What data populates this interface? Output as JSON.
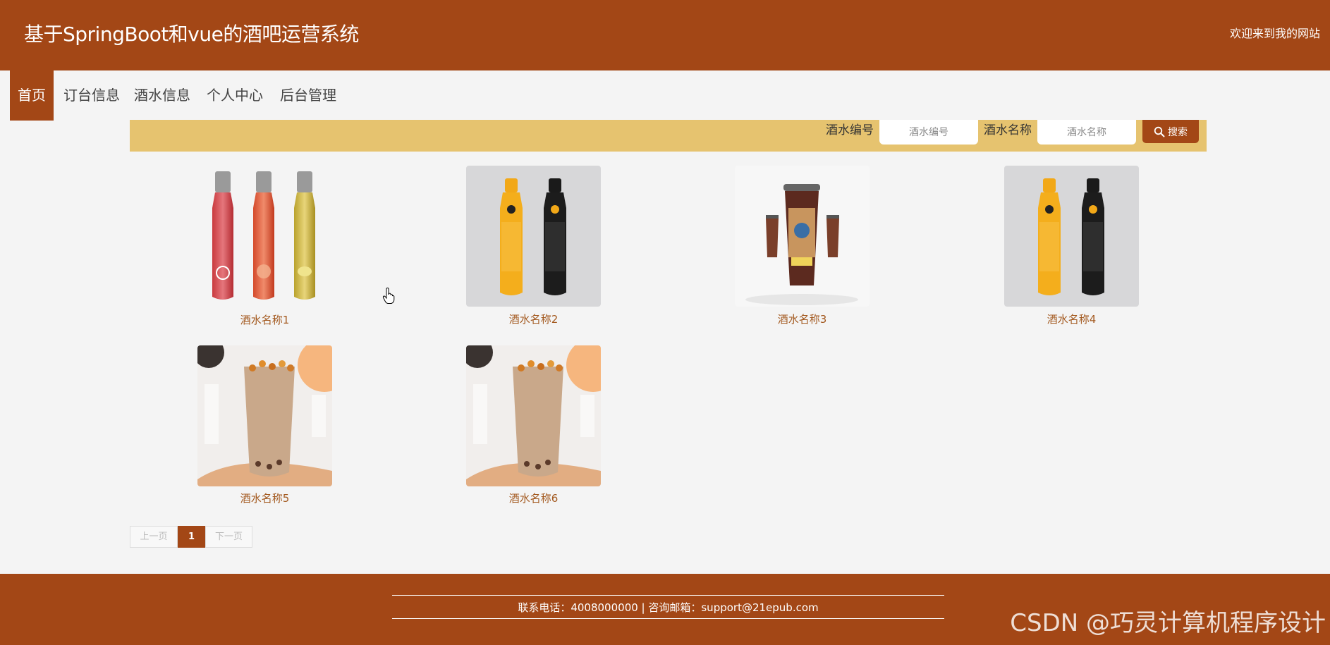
{
  "header": {
    "title": "基于SpringBoot和vue的酒吧运营系统",
    "welcome": "欢迎来到我的网站"
  },
  "nav": {
    "items": [
      {
        "label": "首页",
        "active": true
      },
      {
        "label": "订台信息"
      },
      {
        "label": "酒水信息"
      },
      {
        "label": "个人中心"
      },
      {
        "label": "后台管理"
      }
    ]
  },
  "search": {
    "number_label": "酒水编号",
    "number_placeholder": "酒水编号",
    "name_label": "酒水名称",
    "name_placeholder": "酒水名称",
    "button_label": "搜索",
    "button_icon": "search-icon"
  },
  "products": [
    {
      "name": "酒水名称1",
      "image": "three-bottles"
    },
    {
      "name": "酒水名称2",
      "image": "two-bottles"
    },
    {
      "name": "酒水名称3",
      "image": "cup-product"
    },
    {
      "name": "酒水名称4",
      "image": "two-bottles"
    },
    {
      "name": "酒水名称5",
      "image": "milk-tea"
    },
    {
      "name": "酒水名称6",
      "image": "milk-tea"
    }
  ],
  "pagination": {
    "prev": "上一页",
    "current": "1",
    "next": "下一页"
  },
  "footer": {
    "contact": "联系电话：4008000000 | 咨询邮箱：support@21epub.com",
    "watermark": "CSDN @巧灵计算机程序设计"
  },
  "colors": {
    "brand": "#a34716",
    "search_bar": "#e6c36f",
    "background": "#f4f4f4",
    "product_name": "#a3591f"
  }
}
